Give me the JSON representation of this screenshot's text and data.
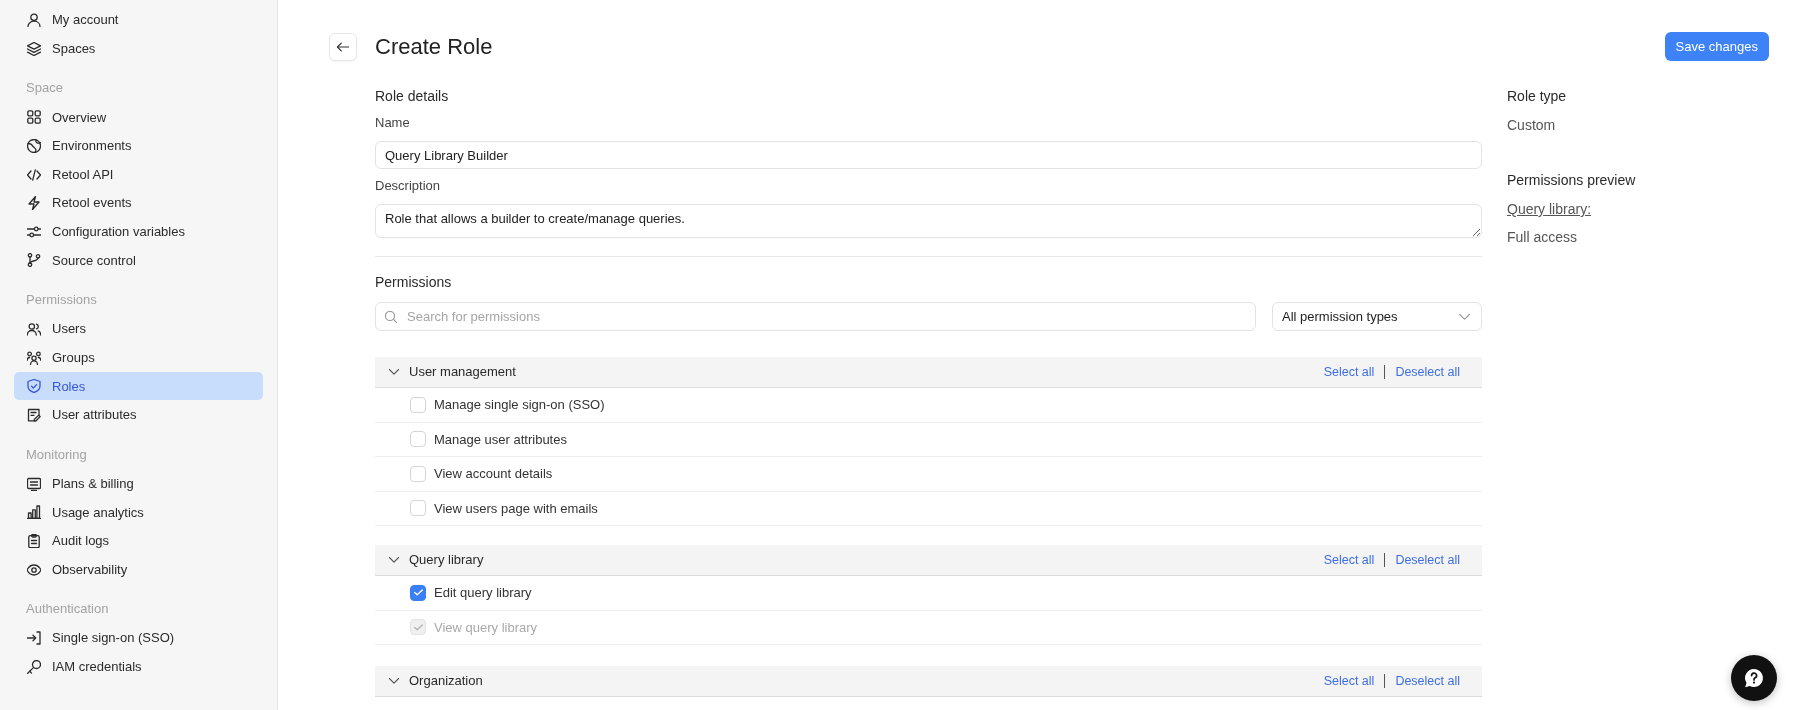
{
  "sidebar": {
    "sections": [
      {
        "items": [
          {
            "label": "My account",
            "selected": false
          },
          {
            "label": "Spaces",
            "selected": false
          }
        ]
      },
      {
        "heading": "Space",
        "items": [
          {
            "label": "Overview",
            "selected": false
          },
          {
            "label": "Environments",
            "selected": false
          },
          {
            "label": "Retool API",
            "selected": false
          },
          {
            "label": "Retool events",
            "selected": false
          },
          {
            "label": "Configuration variables",
            "selected": false
          },
          {
            "label": "Source control",
            "selected": false
          }
        ]
      },
      {
        "heading": "Permissions",
        "items": [
          {
            "label": "Users",
            "selected": false
          },
          {
            "label": "Groups",
            "selected": false
          },
          {
            "label": "Roles",
            "selected": true
          },
          {
            "label": "User attributes",
            "selected": false
          }
        ]
      },
      {
        "heading": "Monitoring",
        "items": [
          {
            "label": "Plans & billing",
            "selected": false
          },
          {
            "label": "Usage analytics",
            "selected": false
          },
          {
            "label": "Audit logs",
            "selected": false
          },
          {
            "label": "Observability",
            "selected": false
          }
        ]
      },
      {
        "heading": "Authentication",
        "items": [
          {
            "label": "Single sign-on (SSO)",
            "selected": false
          },
          {
            "label": "IAM credentials",
            "selected": false
          }
        ]
      }
    ]
  },
  "header": {
    "title": "Create Role",
    "save_button": "Save changes"
  },
  "role_details": {
    "heading": "Role details",
    "name": {
      "label": "Name",
      "value": "Query Library Builder"
    },
    "description": {
      "label": "Description",
      "value": "Role that allows a builder to create/manage queries."
    }
  },
  "permissions": {
    "heading": "Permissions",
    "search": {
      "placeholder": "Search for permissions"
    },
    "type_filter": {
      "value": "All permission types"
    },
    "groups": [
      {
        "title": "User management",
        "expanded": true,
        "select_all": "Select all",
        "deselect_all": "Deselect all",
        "items": [
          {
            "label": "Manage single sign-on (SSO)",
            "checked": false,
            "disabled": false
          },
          {
            "label": "Manage user attributes",
            "checked": false,
            "disabled": false
          },
          {
            "label": "View account details",
            "checked": false,
            "disabled": false
          },
          {
            "label": "View users page with emails",
            "checked": false,
            "disabled": false
          }
        ]
      },
      {
        "title": "Query library",
        "expanded": true,
        "select_all": "Select all",
        "deselect_all": "Deselect all",
        "items": [
          {
            "label": "Edit query library",
            "checked": true,
            "disabled": false
          },
          {
            "label": "View query library",
            "checked": true,
            "disabled": true
          }
        ]
      },
      {
        "title": "Organization",
        "expanded": true,
        "select_all": "Select all",
        "deselect_all": "Deselect all"
      }
    ]
  },
  "side_panel": {
    "role_type": {
      "heading": "Role type",
      "value": "Custom"
    },
    "preview": {
      "heading": "Permissions preview",
      "entries": [
        {
          "label": "Query library:",
          "value": "Full access"
        }
      ]
    }
  }
}
